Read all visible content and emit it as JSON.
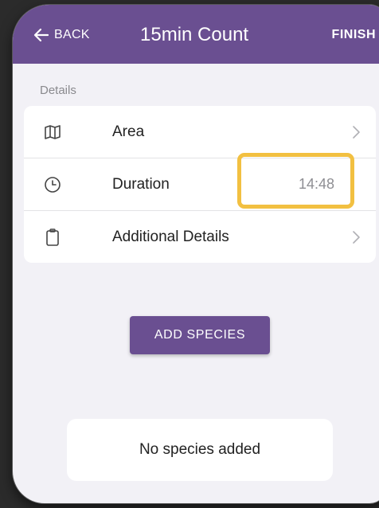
{
  "header": {
    "back_label": "BACK",
    "title": "15min Count",
    "finish_label": "FINISH",
    "bg_color": "#6a4f91"
  },
  "details": {
    "section_label": "Details",
    "rows": [
      {
        "label": "Area",
        "icon": "map-icon"
      },
      {
        "label": "Duration",
        "icon": "clock-icon",
        "value": "14:48"
      },
      {
        "label": "Additional Details",
        "icon": "clipboard-icon"
      }
    ]
  },
  "actions": {
    "add_species_label": "ADD SPECIES"
  },
  "species": {
    "empty_message": "No species added"
  },
  "highlight_color": "#f2c041"
}
